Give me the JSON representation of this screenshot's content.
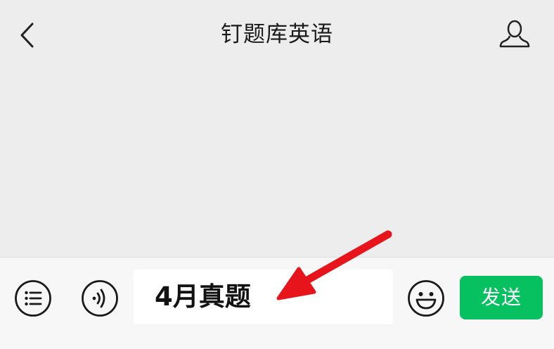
{
  "nav": {
    "title": "钉题库英语",
    "back_icon": "chevron-left-icon",
    "profile_icon": "user-icon"
  },
  "input_bar": {
    "menu_icon": "list-menu-icon",
    "voice_icon": "voice-icon",
    "text_value": "4月真题",
    "emoji_icon": "smiley-icon",
    "send_label": "发送"
  },
  "colors": {
    "background": "#ededed",
    "input_bar": "#f7f7f7",
    "send_button": "#07c160",
    "annotation_arrow": "#e8141b"
  }
}
